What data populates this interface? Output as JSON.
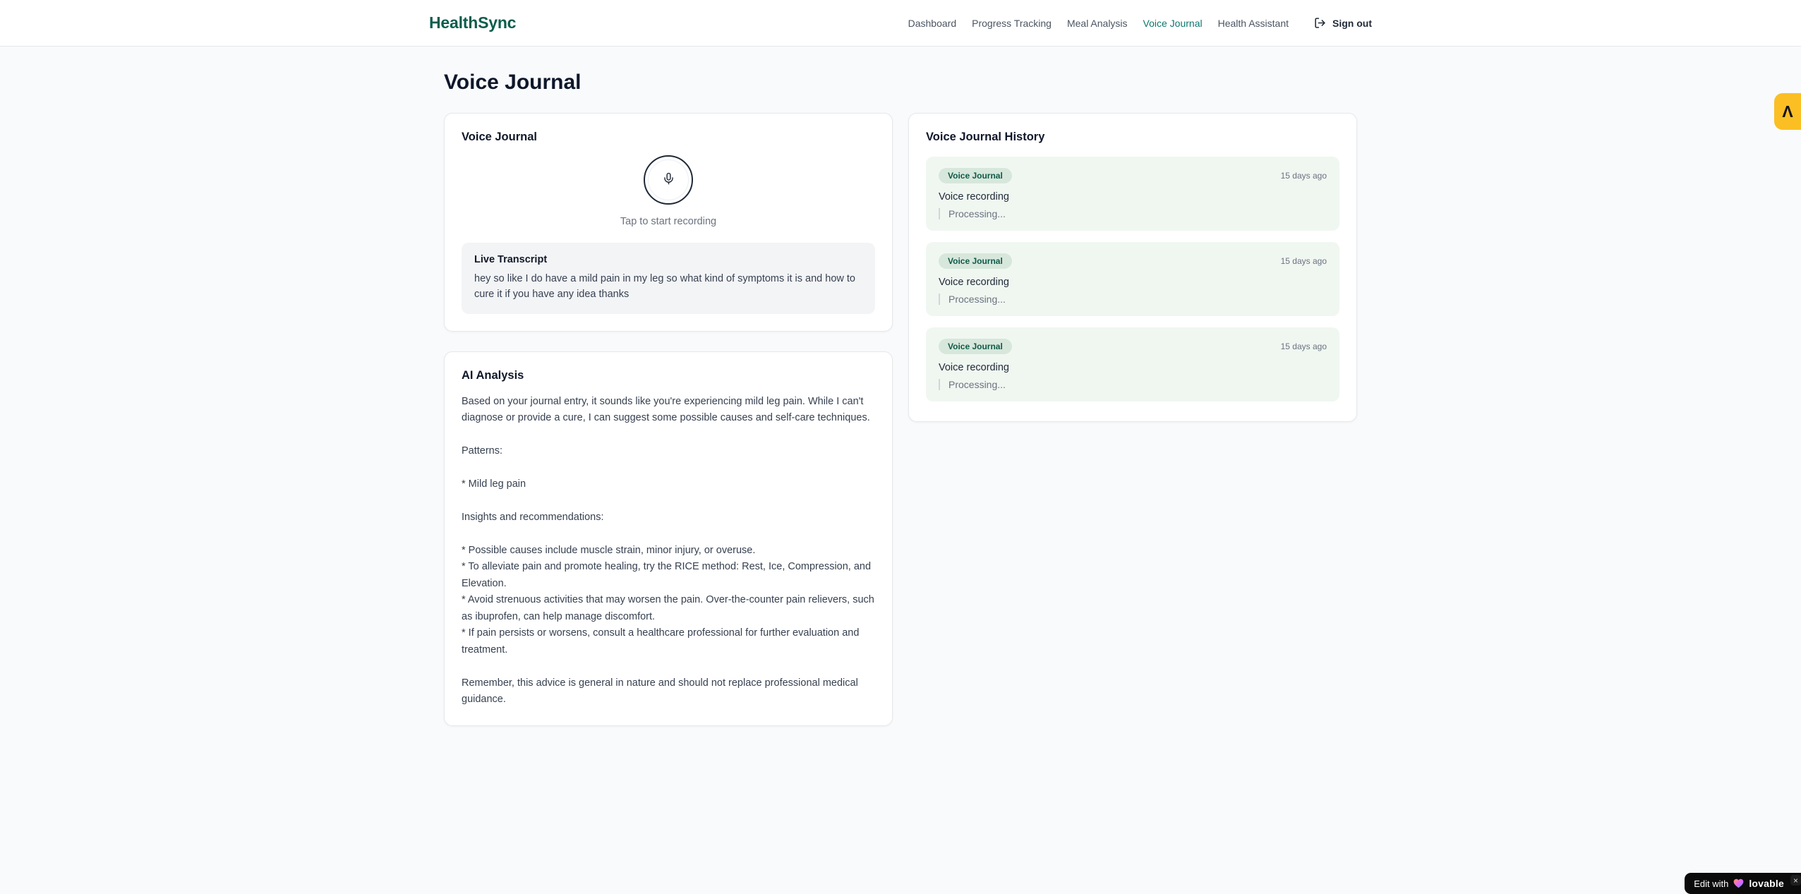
{
  "header": {
    "brand": "HealthSync",
    "nav": [
      {
        "label": "Dashboard",
        "active": false
      },
      {
        "label": "Progress Tracking",
        "active": false
      },
      {
        "label": "Meal Analysis",
        "active": false
      },
      {
        "label": "Voice Journal",
        "active": true
      },
      {
        "label": "Health Assistant",
        "active": false
      }
    ],
    "sign_out_label": "Sign out"
  },
  "page_title": "Voice Journal",
  "recorder": {
    "card_title": "Voice Journal",
    "hint": "Tap to start recording",
    "transcript_title": "Live Transcript",
    "transcript_text": "hey so like I do have a mild pain in my leg so what kind of symptoms it is and how to cure it if you have any idea thanks"
  },
  "analysis": {
    "card_title": "AI Analysis",
    "body": "Based on your journal entry, it sounds like you're experiencing mild leg pain. While I can't diagnose or provide a cure, I can suggest some possible causes and self-care techniques.\n\nPatterns:\n\n* Mild leg pain\n\nInsights and recommendations:\n\n* Possible causes include muscle strain, minor injury, or overuse.\n* To alleviate pain and promote healing, try the RICE method: Rest, Ice, Compression, and Elevation.\n* Avoid strenuous activities that may worsen the pain. Over-the-counter pain relievers, such as ibuprofen, can help manage discomfort.\n* If pain persists or worsens, consult a healthcare professional for further evaluation and treatment.\n\nRemember, this advice is general in nature and should not replace professional medical guidance."
  },
  "history": {
    "card_title": "Voice Journal History",
    "entries": [
      {
        "badge": "Voice Journal",
        "time": "15 days ago",
        "title": "Voice recording",
        "status": "Processing..."
      },
      {
        "badge": "Voice Journal",
        "time": "15 days ago",
        "title": "Voice recording",
        "status": "Processing..."
      },
      {
        "badge": "Voice Journal",
        "time": "15 days ago",
        "title": "Voice recording",
        "status": "Processing..."
      }
    ]
  },
  "overlays": {
    "side_button_glyph": "Λ",
    "edit_badge_prefix": "Edit with",
    "edit_badge_brand": "lovable",
    "edit_badge_close": "×"
  },
  "colors": {
    "brand_green": "#0b5d4d",
    "nav_active_teal": "#0f766e",
    "page_bg": "#f8fafc",
    "entry_bg": "#f0f7f1",
    "badge_bg": "#d7e7db",
    "badge_text": "#0e5a4a",
    "side_button_amber": "#fbbf24",
    "pill_bg": "#0b0b0c"
  }
}
